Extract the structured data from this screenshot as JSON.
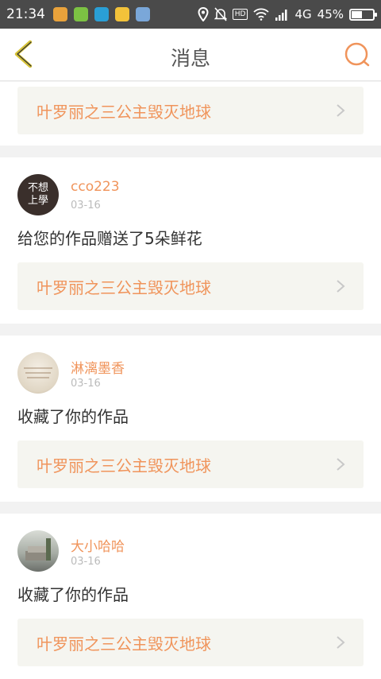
{
  "status_bar": {
    "time": "21:34",
    "network": "4G",
    "battery": "45%",
    "battery_level": 0.45,
    "hd_label": "HD",
    "app_icon_colors": [
      "#e9a23b",
      "#7cc243",
      "#2a9fd6",
      "#f2c23a",
      "#7aa7d9"
    ]
  },
  "nav": {
    "title": "消息",
    "back_icon": "back-chevron-icon",
    "message_icon": "chat-bubble-icon",
    "accent_back": "#d6c236",
    "accent_msg": "#f0945b"
  },
  "messages": [
    {
      "work_title": "叶罗丽之三公主毁灭地球"
    },
    {
      "username": "cco223",
      "avatar_text": [
        "不想",
        "上學"
      ],
      "date": "03-16",
      "action": "给您的作品赠送了5朵鲜花",
      "work_title": "叶罗丽之三公主毁灭地球"
    },
    {
      "username": "淋漓墨香",
      "date": "03-16",
      "action": "收藏了你的作品",
      "work_title": "叶罗丽之三公主毁灭地球"
    },
    {
      "username": "大小哈哈",
      "date": "03-16",
      "action": "收藏了你的作品",
      "work_title": "叶罗丽之三公主毁灭地球"
    }
  ],
  "colors": {
    "accent": "#f0945b",
    "work_box_bg": "#f5f5f0",
    "separator": "#f2f2f2"
  }
}
